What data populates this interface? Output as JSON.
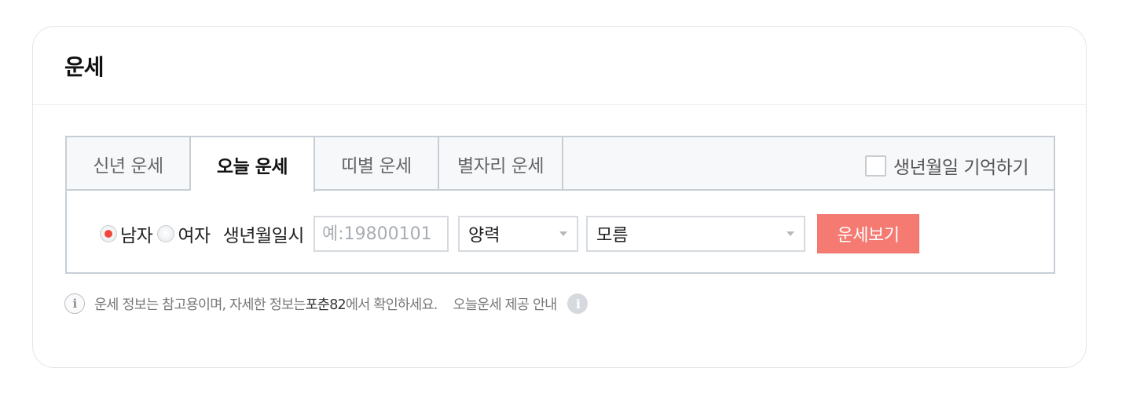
{
  "card": {
    "title": "운세"
  },
  "tabs": [
    {
      "label": "신년 운세",
      "active": false
    },
    {
      "label": "오늘 운세",
      "active": true
    },
    {
      "label": "띠별 운세",
      "active": false
    },
    {
      "label": "별자리 운세",
      "active": false
    }
  ],
  "remember": {
    "label": "생년월일 기억하기",
    "checked": false
  },
  "form": {
    "gender_male": "남자",
    "gender_female": "여자",
    "selected_gender": "남자",
    "birth_label": "생년월일시",
    "birth_placeholder": "예:19800101",
    "birth_value": "",
    "calendar_value": "양력",
    "time_value": "모름",
    "submit_label": "운세보기"
  },
  "notice": {
    "info_icon": "i",
    "text_before": "운세 정보는 참고용이며, 자세한 정보는 ",
    "brand": "포춘82",
    "text_after": " 에서 확인하세요.",
    "provider_link": "오늘운세 제공 안내",
    "provider_info_icon": "i"
  },
  "colors": {
    "accent_button": "#f47a72",
    "radio_checked": "#f0463c",
    "panel_border": "#c7ced6"
  }
}
